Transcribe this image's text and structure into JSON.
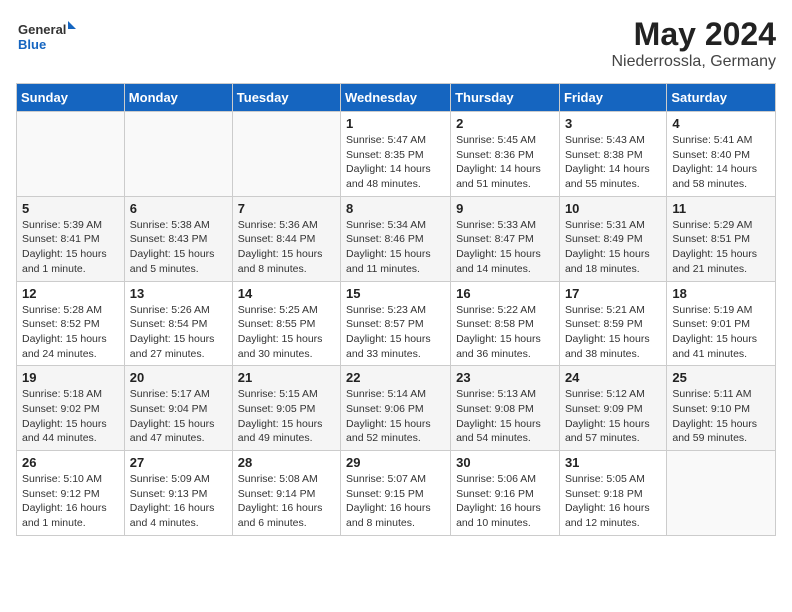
{
  "header": {
    "logo_general": "General",
    "logo_blue": "Blue",
    "month": "May 2024",
    "location": "Niederrossla, Germany"
  },
  "weekdays": [
    "Sunday",
    "Monday",
    "Tuesday",
    "Wednesday",
    "Thursday",
    "Friday",
    "Saturday"
  ],
  "weeks": [
    [
      {
        "day": "",
        "info": ""
      },
      {
        "day": "",
        "info": ""
      },
      {
        "day": "",
        "info": ""
      },
      {
        "day": "1",
        "info": "Sunrise: 5:47 AM\nSunset: 8:35 PM\nDaylight: 14 hours\nand 48 minutes."
      },
      {
        "day": "2",
        "info": "Sunrise: 5:45 AM\nSunset: 8:36 PM\nDaylight: 14 hours\nand 51 minutes."
      },
      {
        "day": "3",
        "info": "Sunrise: 5:43 AM\nSunset: 8:38 PM\nDaylight: 14 hours\nand 55 minutes."
      },
      {
        "day": "4",
        "info": "Sunrise: 5:41 AM\nSunset: 8:40 PM\nDaylight: 14 hours\nand 58 minutes."
      }
    ],
    [
      {
        "day": "5",
        "info": "Sunrise: 5:39 AM\nSunset: 8:41 PM\nDaylight: 15 hours\nand 1 minute."
      },
      {
        "day": "6",
        "info": "Sunrise: 5:38 AM\nSunset: 8:43 PM\nDaylight: 15 hours\nand 5 minutes."
      },
      {
        "day": "7",
        "info": "Sunrise: 5:36 AM\nSunset: 8:44 PM\nDaylight: 15 hours\nand 8 minutes."
      },
      {
        "day": "8",
        "info": "Sunrise: 5:34 AM\nSunset: 8:46 PM\nDaylight: 15 hours\nand 11 minutes."
      },
      {
        "day": "9",
        "info": "Sunrise: 5:33 AM\nSunset: 8:47 PM\nDaylight: 15 hours\nand 14 minutes."
      },
      {
        "day": "10",
        "info": "Sunrise: 5:31 AM\nSunset: 8:49 PM\nDaylight: 15 hours\nand 18 minutes."
      },
      {
        "day": "11",
        "info": "Sunrise: 5:29 AM\nSunset: 8:51 PM\nDaylight: 15 hours\nand 21 minutes."
      }
    ],
    [
      {
        "day": "12",
        "info": "Sunrise: 5:28 AM\nSunset: 8:52 PM\nDaylight: 15 hours\nand 24 minutes."
      },
      {
        "day": "13",
        "info": "Sunrise: 5:26 AM\nSunset: 8:54 PM\nDaylight: 15 hours\nand 27 minutes."
      },
      {
        "day": "14",
        "info": "Sunrise: 5:25 AM\nSunset: 8:55 PM\nDaylight: 15 hours\nand 30 minutes."
      },
      {
        "day": "15",
        "info": "Sunrise: 5:23 AM\nSunset: 8:57 PM\nDaylight: 15 hours\nand 33 minutes."
      },
      {
        "day": "16",
        "info": "Sunrise: 5:22 AM\nSunset: 8:58 PM\nDaylight: 15 hours\nand 36 minutes."
      },
      {
        "day": "17",
        "info": "Sunrise: 5:21 AM\nSunset: 8:59 PM\nDaylight: 15 hours\nand 38 minutes."
      },
      {
        "day": "18",
        "info": "Sunrise: 5:19 AM\nSunset: 9:01 PM\nDaylight: 15 hours\nand 41 minutes."
      }
    ],
    [
      {
        "day": "19",
        "info": "Sunrise: 5:18 AM\nSunset: 9:02 PM\nDaylight: 15 hours\nand 44 minutes."
      },
      {
        "day": "20",
        "info": "Sunrise: 5:17 AM\nSunset: 9:04 PM\nDaylight: 15 hours\nand 47 minutes."
      },
      {
        "day": "21",
        "info": "Sunrise: 5:15 AM\nSunset: 9:05 PM\nDaylight: 15 hours\nand 49 minutes."
      },
      {
        "day": "22",
        "info": "Sunrise: 5:14 AM\nSunset: 9:06 PM\nDaylight: 15 hours\nand 52 minutes."
      },
      {
        "day": "23",
        "info": "Sunrise: 5:13 AM\nSunset: 9:08 PM\nDaylight: 15 hours\nand 54 minutes."
      },
      {
        "day": "24",
        "info": "Sunrise: 5:12 AM\nSunset: 9:09 PM\nDaylight: 15 hours\nand 57 minutes."
      },
      {
        "day": "25",
        "info": "Sunrise: 5:11 AM\nSunset: 9:10 PM\nDaylight: 15 hours\nand 59 minutes."
      }
    ],
    [
      {
        "day": "26",
        "info": "Sunrise: 5:10 AM\nSunset: 9:12 PM\nDaylight: 16 hours\nand 1 minute."
      },
      {
        "day": "27",
        "info": "Sunrise: 5:09 AM\nSunset: 9:13 PM\nDaylight: 16 hours\nand 4 minutes."
      },
      {
        "day": "28",
        "info": "Sunrise: 5:08 AM\nSunset: 9:14 PM\nDaylight: 16 hours\nand 6 minutes."
      },
      {
        "day": "29",
        "info": "Sunrise: 5:07 AM\nSunset: 9:15 PM\nDaylight: 16 hours\nand 8 minutes."
      },
      {
        "day": "30",
        "info": "Sunrise: 5:06 AM\nSunset: 9:16 PM\nDaylight: 16 hours\nand 10 minutes."
      },
      {
        "day": "31",
        "info": "Sunrise: 5:05 AM\nSunset: 9:18 PM\nDaylight: 16 hours\nand 12 minutes."
      },
      {
        "day": "",
        "info": ""
      }
    ]
  ]
}
